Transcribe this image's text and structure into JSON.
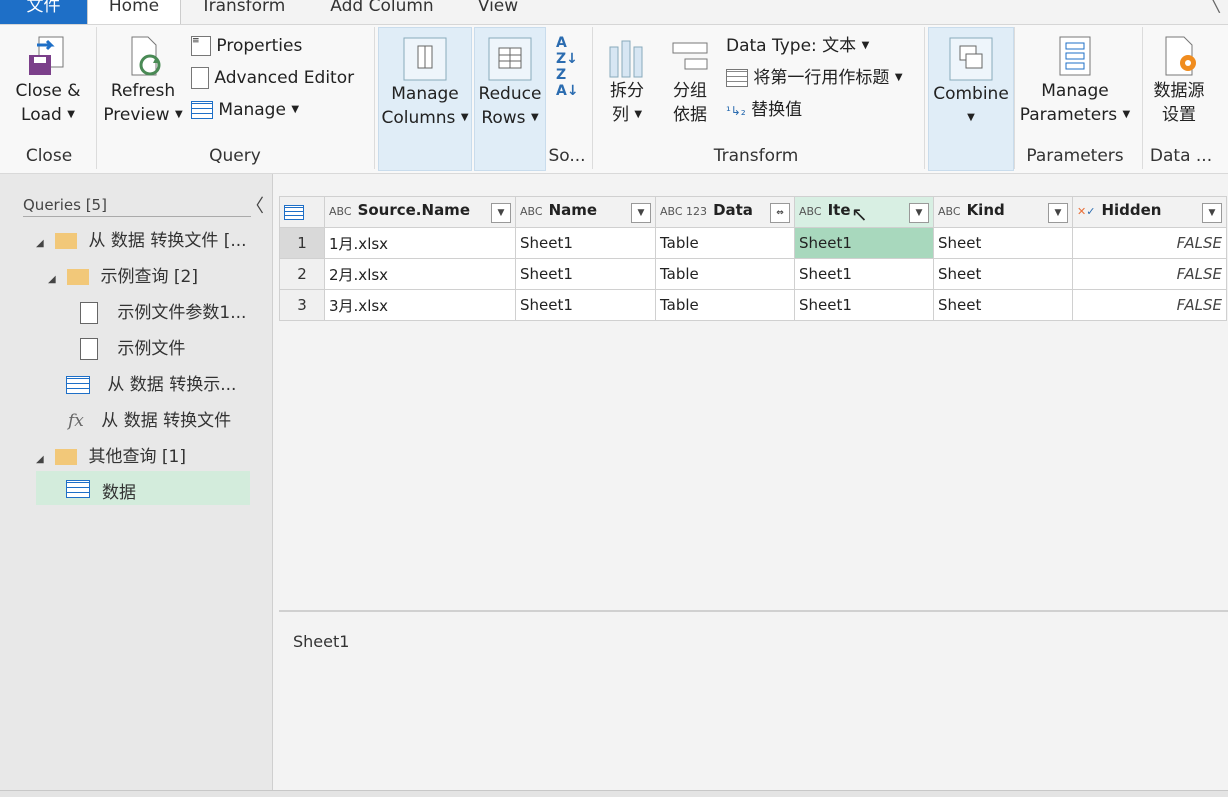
{
  "tabs": [
    "文件",
    "Home",
    "Transform",
    "Add Column",
    "View"
  ],
  "ribbon": {
    "close_group": {
      "label": "Close",
      "close_load": "Close &",
      "close_load2": "Load"
    },
    "query_group": {
      "label": "Query",
      "refresh": "Refresh",
      "refresh2": "Preview",
      "properties": "Properties",
      "advanced_editor": "Advanced Editor",
      "manage": "Manage"
    },
    "manage_columns": {
      "line1": "Manage",
      "line2": "Columns"
    },
    "reduce_rows": {
      "line1": "Reduce",
      "line2": "Rows"
    },
    "sort_group": {
      "label": "So..."
    },
    "transform_group": {
      "label": "Transform",
      "split1": "拆分",
      "split2": "列",
      "group1": "分组",
      "group2": "依据",
      "data_type": "Data Type: 文本",
      "first_row_header": "将第一行用作标题",
      "replace_values": "替换值"
    },
    "combine": {
      "label": "Combine"
    },
    "parameters_group": {
      "label": "Parameters",
      "line1": "Manage",
      "line2": "Parameters"
    },
    "data_group": {
      "label": "Data ...",
      "line1": "数据源",
      "line2": "设置"
    }
  },
  "queries": {
    "header": "Queries [5]",
    "items": [
      {
        "label": "从 数据 转换文件 [..."
      },
      {
        "label": "示例查询 [2]"
      },
      {
        "label": "示例文件参数1..."
      },
      {
        "label": "示例文件"
      },
      {
        "label": "从 数据 转换示..."
      },
      {
        "label": "从 数据 转换文件"
      },
      {
        "label": "其他查询 [1]"
      },
      {
        "label": "数据"
      }
    ]
  },
  "grid": {
    "columns": [
      {
        "name": "Source.Name",
        "type": "ABC"
      },
      {
        "name": "Name",
        "type": "ABC"
      },
      {
        "name": "Data",
        "type": "ABC 123"
      },
      {
        "name": "Ite",
        "type": "ABC"
      },
      {
        "name": "Kind",
        "type": "ABC"
      },
      {
        "name": "Hidden",
        "type": "bool"
      }
    ],
    "rows": [
      {
        "num": "1",
        "cells": [
          "1月.xlsx",
          "Sheet1",
          "Table",
          "Sheet1",
          "Sheet",
          "FALSE"
        ]
      },
      {
        "num": "2",
        "cells": [
          "2月.xlsx",
          "Sheet1",
          "Table",
          "Sheet1",
          "Sheet",
          "FALSE"
        ]
      },
      {
        "num": "3",
        "cells": [
          "3月.xlsx",
          "Sheet1",
          "Table",
          "Sheet1",
          "Sheet",
          "FALSE"
        ]
      }
    ]
  },
  "preview": {
    "value": "Sheet1"
  },
  "colors": {
    "file_tab": "#1e6fc7",
    "selection": "#a8d8bd",
    "header_selected": "#d8efe3",
    "query_selected": "#d3ecdc"
  }
}
